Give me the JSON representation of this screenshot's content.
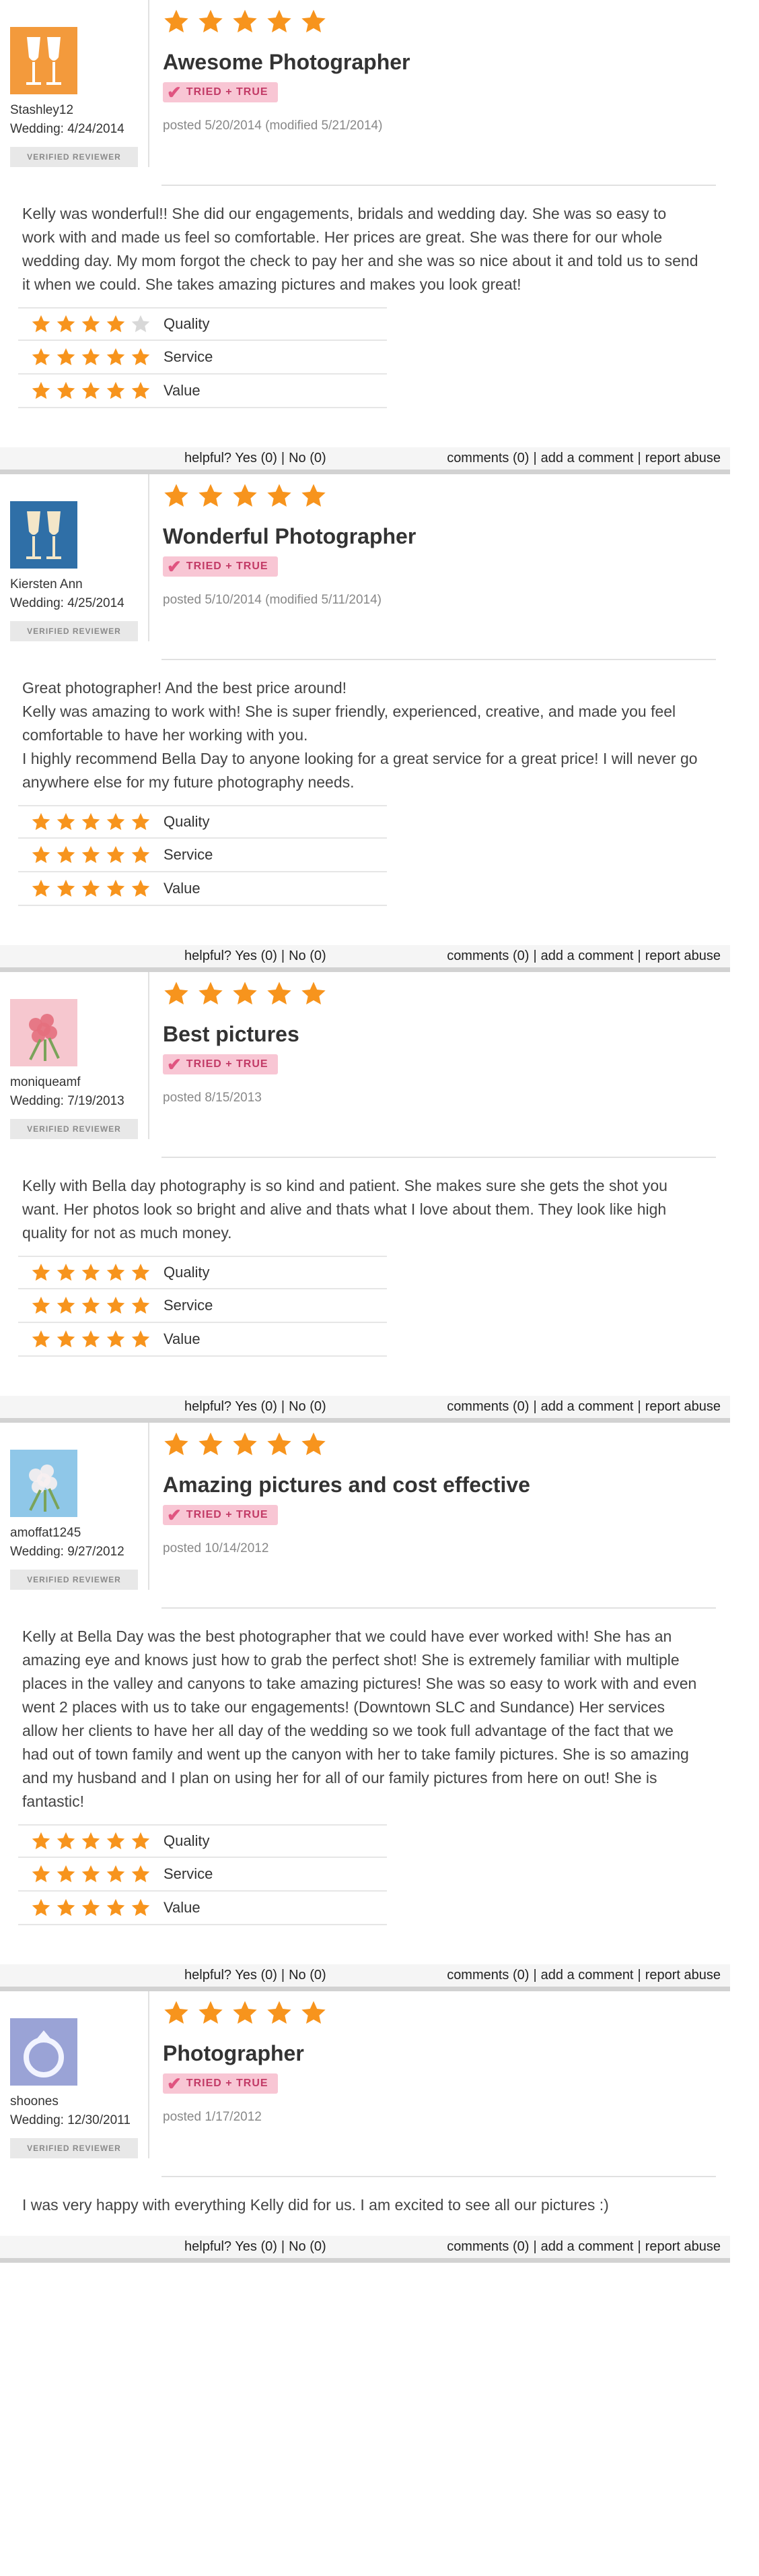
{
  "labels": {
    "tried_true": "TRIED + TRUE",
    "verified": "VERIFIED REVIEWER",
    "helpful": "helpful?",
    "yes": "Yes (0)",
    "no": "No (0)",
    "comments": "comments (0)",
    "add_comment": "add a comment",
    "report": "report abuse"
  },
  "colors": {
    "star_on": "#f7941d",
    "star_off": "#d8d8d8",
    "accent_pink": "#f8c6d4"
  },
  "reviews": [
    {
      "avatar": "champagne-glasses-orange",
      "reviewer": "Stashley12",
      "wedding": "Wedding: 4/24/2014",
      "overall": 5,
      "title": "Awesome Photographer",
      "posted": "posted 5/20/2014 (modified 5/21/2014)",
      "text": "Kelly was wonderful!! She did our engagements, bridals and wedding day. She was so easy to work with and made us feel so comfortable. Her prices are great. She was there for our whole wedding day. My mom forgot the check to pay her and she was so nice about it and told us to send it when we could. She takes amazing pictures and makes you look great!",
      "ratings": [
        {
          "label": "Quality",
          "value": 4
        },
        {
          "label": "Service",
          "value": 5
        },
        {
          "label": "Value",
          "value": 5
        }
      ]
    },
    {
      "avatar": "champagne-glasses-blue",
      "reviewer": "Kiersten Ann",
      "wedding": "Wedding: 4/25/2014",
      "overall": 5,
      "title": "Wonderful Photographer",
      "posted": "posted 5/10/2014 (modified 5/11/2014)",
      "text": "Great photographer! And the best price around!\nKelly was amazing to work with! She is super friendly, experienced, creative, and made you feel comfortable to have her working with you.\nI highly recommend Bella Day to anyone looking for a great service for a great price! I will never go anywhere else for my future photography needs.",
      "ratings": [
        {
          "label": "Quality",
          "value": 5
        },
        {
          "label": "Service",
          "value": 5
        },
        {
          "label": "Value",
          "value": 5
        }
      ]
    },
    {
      "avatar": "bouquet-pink",
      "reviewer": "moniqueamf",
      "wedding": "Wedding: 7/19/2013",
      "overall": 5,
      "title": "Best pictures",
      "posted": "posted 8/15/2013",
      "text": "Kelly with Bella day photography is so kind and patient. She makes sure she gets the shot you want. Her photos look so bright and alive and thats what I love about them. They look like high quality for not as much money.",
      "ratings": [
        {
          "label": "Quality",
          "value": 5
        },
        {
          "label": "Service",
          "value": 5
        },
        {
          "label": "Value",
          "value": 5
        }
      ]
    },
    {
      "avatar": "bouquet-blue",
      "reviewer": "amoffat1245",
      "wedding": "Wedding: 9/27/2012",
      "overall": 5,
      "title": "Amazing pictures and cost effective",
      "posted": "posted 10/14/2012",
      "text": "Kelly at Bella Day was the best photographer that we could have ever worked with! She has an amazing eye and knows just how to grab the perfect shot! She is extremely familiar with multiple places in the valley and canyons to take amazing pictures! She was so easy to work with and even went 2 places with us to take our engagements! (Downtown SLC and Sundance) Her services allow her clients to have her all day of the wedding so we took full advantage of the fact that we had out of town family and went up the canyon with her to take family pictures. She is so amazing and my husband and I plan on using her for all of our family pictures from here on out! She is fantastic!",
      "ratings": [
        {
          "label": "Quality",
          "value": 5
        },
        {
          "label": "Service",
          "value": 5
        },
        {
          "label": "Value",
          "value": 5
        }
      ]
    },
    {
      "avatar": "ring-purple",
      "reviewer": "shoones",
      "wedding": "Wedding: 12/30/2011",
      "overall": 5,
      "title": "Photographer",
      "posted": "posted 1/17/2012",
      "text": "I was very happy with everything Kelly did for us. I am excited to see all our pictures :)",
      "ratings": []
    }
  ]
}
